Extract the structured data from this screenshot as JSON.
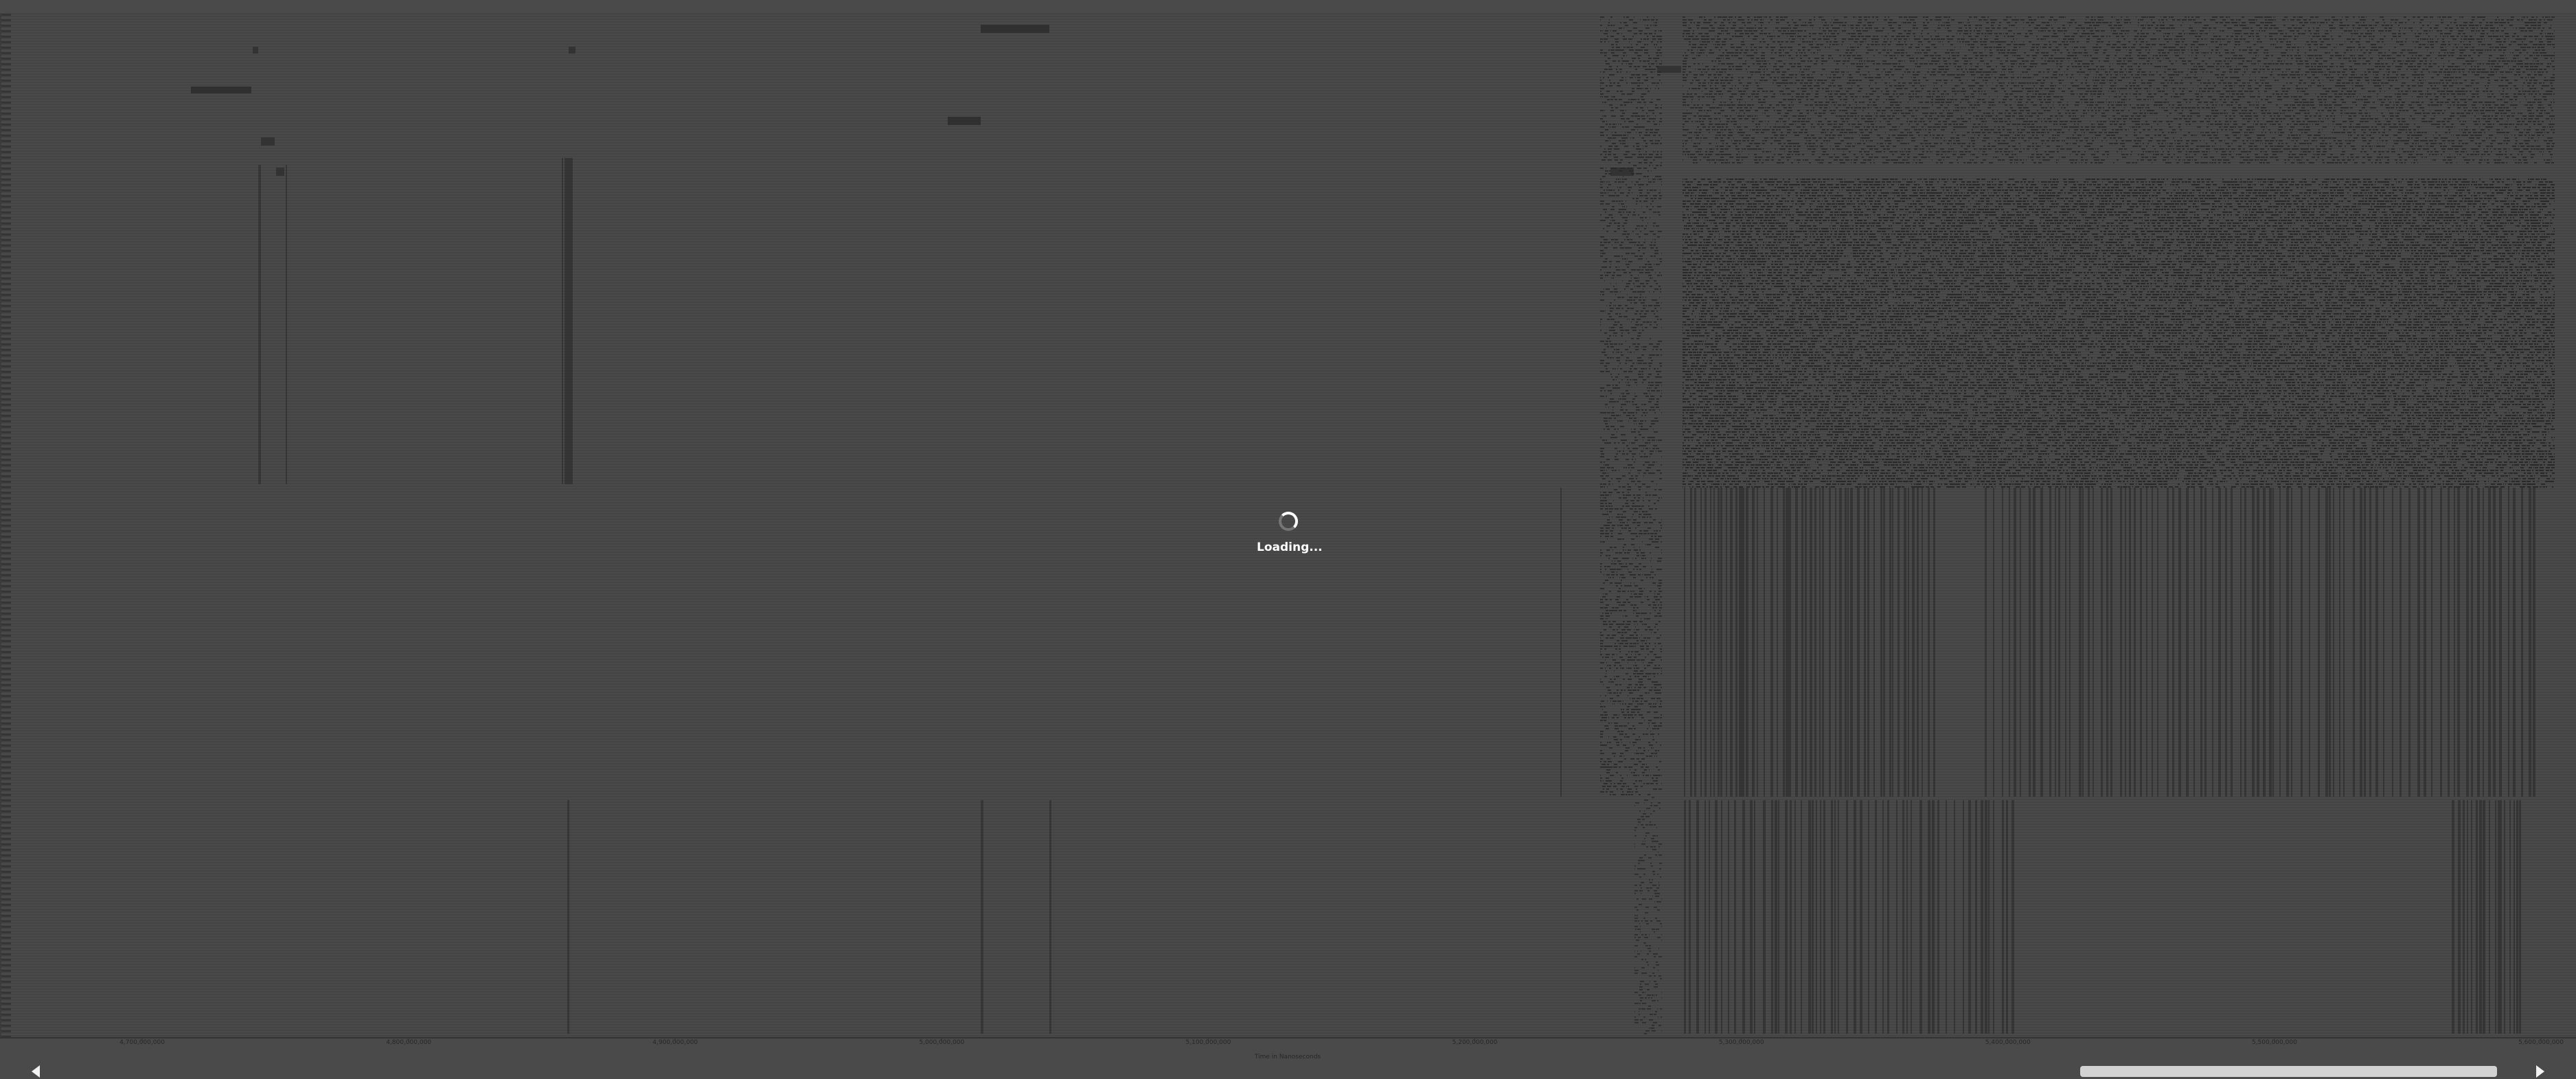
{
  "status": {
    "loading_text": "Loading..."
  },
  "timeline": {
    "axis_title": "Time in Nanoseconds",
    "ticks": [
      "4,700,000,000",
      "4,800,000,000",
      "4,900,000,000",
      "5,000,000,000",
      "5,100,000,000",
      "5,200,000,000",
      "5,300,000,000",
      "5,400,000,000",
      "5,500,000,000",
      "5,600,000,000"
    ]
  },
  "scrollbar": {
    "thumb_start": 0.818,
    "thumb_end": 0.985
  },
  "colors": {
    "background": "#4a4a4a",
    "row_line": "#3d3d3d",
    "event": "#262626",
    "spinner": "#ffffff"
  }
}
